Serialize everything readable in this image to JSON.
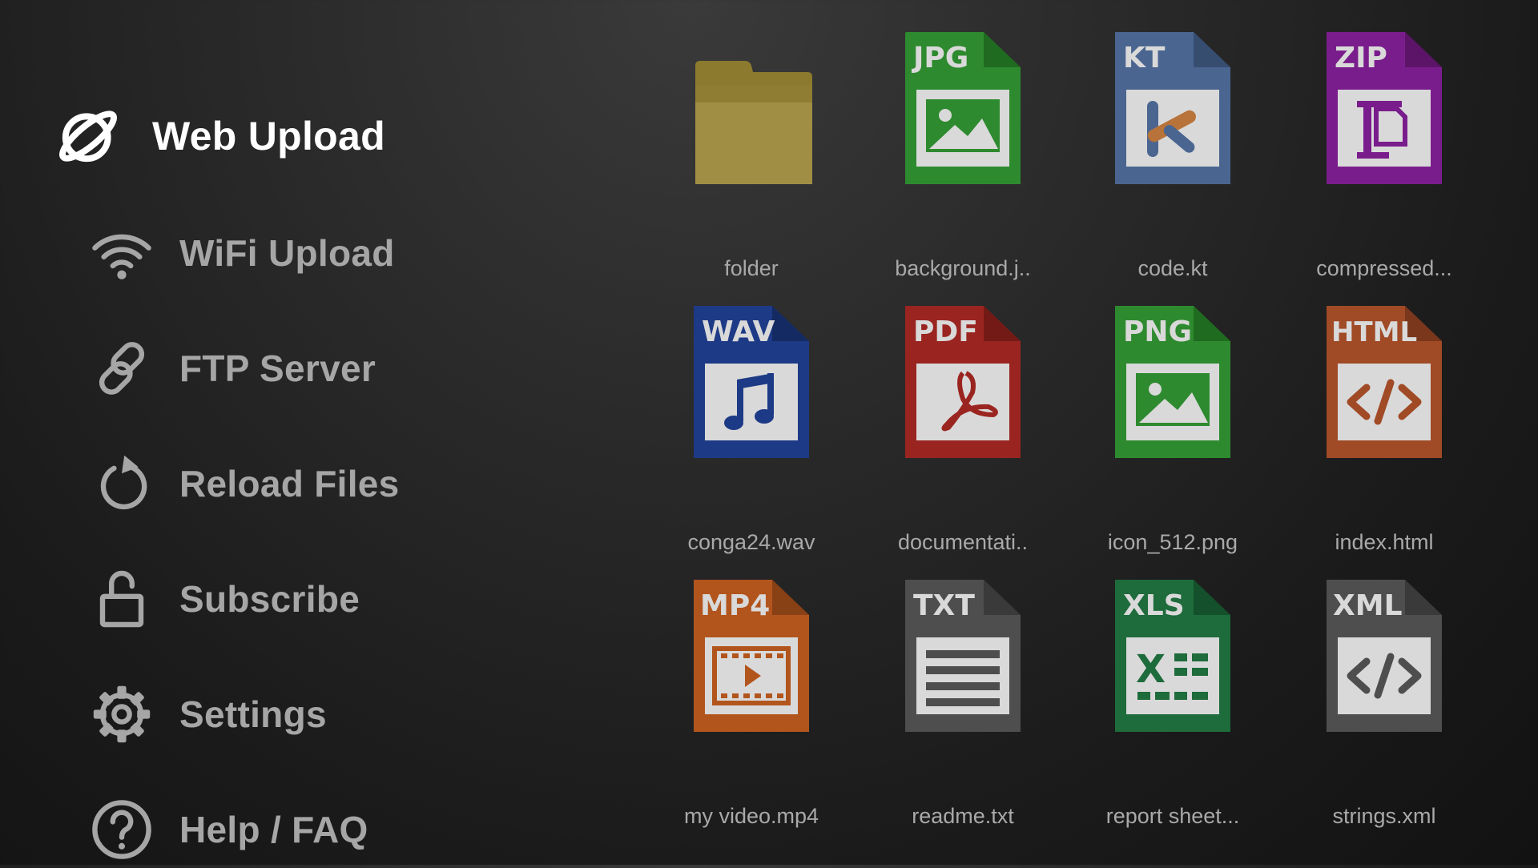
{
  "sidebar": {
    "title": "Web Upload",
    "title_icon": "planet-icon",
    "items": [
      {
        "label": "WiFi Upload",
        "icon": "wifi-icon"
      },
      {
        "label": "FTP Server",
        "icon": "link-icon"
      },
      {
        "label": "Reload Files",
        "icon": "reload-icon"
      },
      {
        "label": "Subscribe",
        "icon": "unlock-icon"
      },
      {
        "label": "Settings",
        "icon": "gear-icon"
      },
      {
        "label": "Help / FAQ",
        "icon": "help-icon"
      }
    ]
  },
  "files": [
    {
      "name": "folder",
      "type": "folder",
      "badge": "",
      "color": "#8c7a2e"
    },
    {
      "name": "background.j..",
      "type": "image",
      "badge": "JPG",
      "color": "#2e8a2f"
    },
    {
      "name": "code.kt",
      "type": "kotlin",
      "badge": "KT",
      "color": "#4a6590"
    },
    {
      "name": "compressed...",
      "type": "archive",
      "badge": "ZIP",
      "color": "#7a1d8c"
    },
    {
      "name": "conga24.wav",
      "type": "audio",
      "badge": "WAV",
      "color": "#1d3a86"
    },
    {
      "name": "documentati..",
      "type": "pdf",
      "badge": "PDF",
      "color": "#9a2520"
    },
    {
      "name": "icon_512.png",
      "type": "image",
      "badge": "PNG",
      "color": "#2e8a2f"
    },
    {
      "name": "index.html",
      "type": "code",
      "badge": "HTML",
      "color": "#a04a26"
    },
    {
      "name": "my video.mp4",
      "type": "video",
      "badge": "MP4",
      "color": "#b2551d"
    },
    {
      "name": "readme.txt",
      "type": "text",
      "badge": "TXT",
      "color": "#4e4e4e"
    },
    {
      "name": "report sheet...",
      "type": "sheet",
      "badge": "XLS",
      "color": "#1e6b3c"
    },
    {
      "name": "strings.xml",
      "type": "code",
      "badge": "XML",
      "color": "#4e4e4e"
    }
  ]
}
